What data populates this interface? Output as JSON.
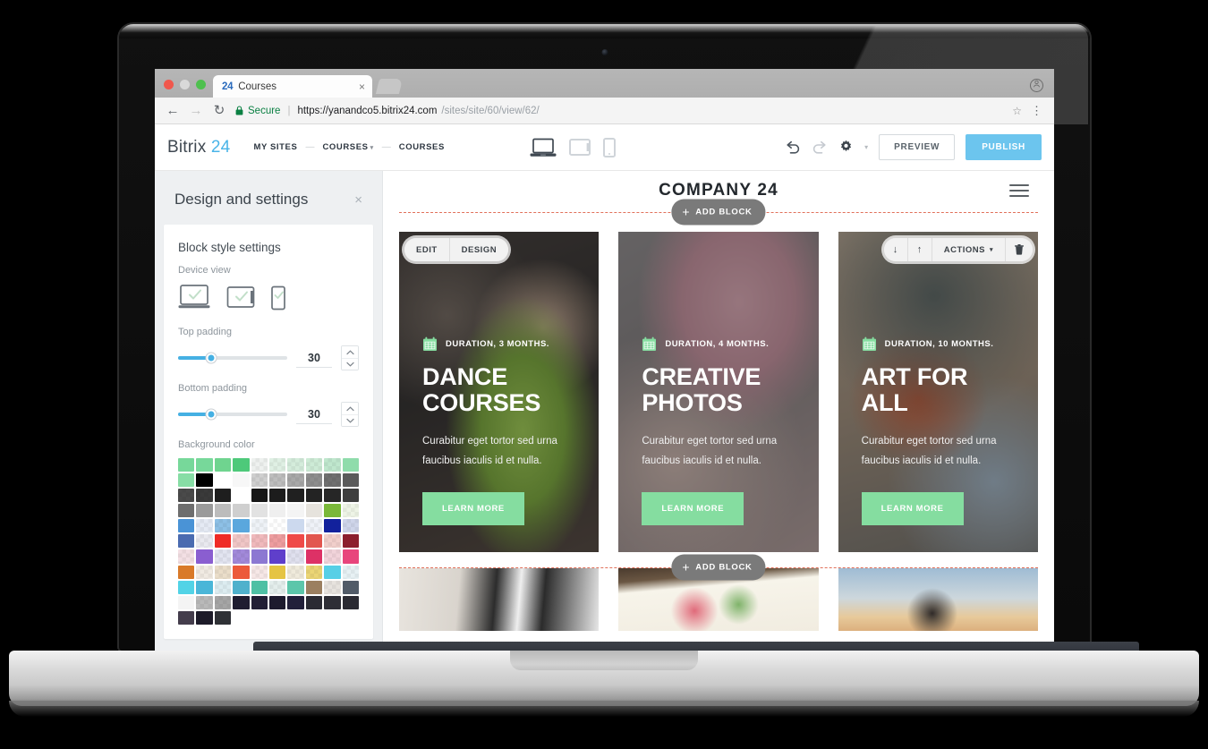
{
  "browser": {
    "tab": {
      "favicon_text": "24",
      "title": "Courses",
      "close_label": "×"
    },
    "newtab_label": "",
    "profile_icon": "ↀ",
    "back_label": "←",
    "forward_label": "→",
    "reload_label": "↻",
    "security_label": "Secure",
    "lock_icon": "🔒",
    "url_strong": "https://yanandco5.bitrix24.com",
    "url_dim": "/sites/site/60/view/62/",
    "star_icon": "☆",
    "menu_icon": "⋮"
  },
  "appbar": {
    "logo_main": "Bitrix",
    "logo_accent": "24",
    "breadcrumbs": [
      {
        "label": "MY SITES",
        "has_caret": false
      },
      {
        "label": "COURSES",
        "has_caret": true
      },
      {
        "label": "COURSES",
        "has_caret": false
      }
    ],
    "crumb_separator": "—",
    "device_views": [
      "desktop-view-icon",
      "tablet-view-icon",
      "mobile-view-icon"
    ],
    "undo_label": "undo-icon",
    "redo_label": "redo-icon",
    "settings_label": "gear-icon",
    "more_caret": "▾",
    "preview_label": "PREVIEW",
    "publish_label": "PUBLISH",
    "accent_color": "#6cc5ee"
  },
  "panel": {
    "title": "Design and settings",
    "close_label": "×",
    "section_title": "Block style settings",
    "device_view_label": "Device view",
    "device_options": [
      {
        "name": "laptop",
        "checked": true,
        "active": true
      },
      {
        "name": "tablet",
        "checked": true,
        "active": false
      },
      {
        "name": "mobile",
        "checked": true,
        "active": false
      }
    ],
    "top_padding": {
      "label": "Top padding",
      "value": "30",
      "percent": 30
    },
    "bottom_padding": {
      "label": "Bottom padding",
      "value": "30",
      "percent": 30
    },
    "background_color_label": "Background color",
    "stepper_up": "▲",
    "stepper_down": "▼",
    "slider_fill_color": "#45b0e3",
    "swatches": [
      {
        "c": "#77d89a"
      },
      {
        "c": "#77d89a"
      },
      {
        "c": "#6fd48f"
      },
      {
        "c": "#4ec97a"
      },
      {
        "c": "#eef1ef",
        "k": true
      },
      {
        "c": "#dff0e4",
        "k": true
      },
      {
        "c": "#d4ecdb",
        "k": true
      },
      {
        "c": "#cdebd6",
        "k": true
      },
      {
        "c": "#bfe7cd",
        "k": true
      },
      {
        "c": "#8fdcab"
      },
      {
        "c": "#87dda5"
      },
      {
        "c": "#000000"
      },
      {
        "c": "#ffffff"
      },
      {
        "c": "#f7f7f7"
      },
      {
        "c": "#cfcfcf",
        "k": true
      },
      {
        "c": "#bdbdbd",
        "k": true
      },
      {
        "c": "#a8a8a8",
        "k": true
      },
      {
        "c": "#8d8d8d",
        "k": true
      },
      {
        "c": "#6f6f6f",
        "k": true
      },
      {
        "c": "#5a5a5a"
      },
      {
        "c": "#4a4a4a",
        "k": true
      },
      {
        "c": "#3a3a3a",
        "k": true
      },
      {
        "c": "#1e1e1e"
      },
      {
        "c": "#ffffff"
      },
      {
        "c": "#171717"
      },
      {
        "c": "#1c1c1c"
      },
      {
        "c": "#202020"
      },
      {
        "c": "#232323"
      },
      {
        "c": "#262626"
      },
      {
        "c": "#3f3f3f"
      },
      {
        "c": "#6e6e6e"
      },
      {
        "c": "#9a9a9a"
      },
      {
        "c": "#bcbcbc"
      },
      {
        "c": "#cfcfcf"
      },
      {
        "c": "#e2e2e2"
      },
      {
        "c": "#efefef"
      },
      {
        "c": "#f4f4f4"
      },
      {
        "c": "#e6e3dd"
      },
      {
        "c": "#7ab839"
      },
      {
        "c": "#eef4e6",
        "k": true
      },
      {
        "c": "#4a93d6"
      },
      {
        "c": "#e5eaf4",
        "k": true
      },
      {
        "c": "#8dc0e6",
        "k": true
      },
      {
        "c": "#5aa7dd"
      },
      {
        "c": "#eef2f7",
        "k": true
      },
      {
        "c": "#ffffff",
        "k": true
      },
      {
        "c": "#ccd9ee"
      },
      {
        "c": "#eff2f8",
        "k": true
      },
      {
        "c": "#12219c"
      },
      {
        "c": "#cfd5ea",
        "k": true
      },
      {
        "c": "#4a6bb0"
      },
      {
        "c": "#e9e9ef",
        "k": true
      },
      {
        "c": "#ef2b26"
      },
      {
        "c": "#f0c6c6",
        "k": true
      },
      {
        "c": "#f0b9bc",
        "k": true
      },
      {
        "c": "#ee9d9f",
        "k": true
      },
      {
        "c": "#ef4a48"
      },
      {
        "c": "#e2564f"
      },
      {
        "c": "#f1cfcb",
        "k": true
      },
      {
        "c": "#8c1e2d"
      },
      {
        "c": "#f3dfe4",
        "k": true
      },
      {
        "c": "#8a5ed0"
      },
      {
        "c": "#e2e4f0",
        "k": true
      },
      {
        "c": "#a289da",
        "k": true
      },
      {
        "c": "#8c78d2"
      },
      {
        "c": "#5f3fcb"
      },
      {
        "c": "#dfe0ee",
        "k": true
      },
      {
        "c": "#dd3166"
      },
      {
        "c": "#f1d3da",
        "k": true
      },
      {
        "c": "#e8457c"
      },
      {
        "c": "#d97a29"
      },
      {
        "c": "#f0eae2",
        "k": true
      },
      {
        "c": "#eaddc9",
        "k": true
      },
      {
        "c": "#ec5a3a"
      },
      {
        "c": "#f6e7e6",
        "k": true
      },
      {
        "c": "#e5c443"
      },
      {
        "c": "#efeadb",
        "k": true
      },
      {
        "c": "#ebd575",
        "k": true
      },
      {
        "c": "#57cfe6"
      },
      {
        "c": "#e7f1f4",
        "k": true
      },
      {
        "c": "#52d3e6"
      },
      {
        "c": "#4ab6d8"
      },
      {
        "c": "#dcecf0",
        "k": true
      },
      {
        "c": "#4fb1cc"
      },
      {
        "c": "#4fc0a4"
      },
      {
        "c": "#e4eeec",
        "k": true
      },
      {
        "c": "#5cc6aa"
      },
      {
        "c": "#9b7f60"
      },
      {
        "c": "#e7e3de",
        "k": true
      },
      {
        "c": "#515b68"
      },
      {
        "c": "#f4f4f4"
      },
      {
        "c": "#b9b9b9",
        "k": true
      },
      {
        "c": "#a5a5a5",
        "k": true
      },
      {
        "c": "#1f1d31"
      },
      {
        "c": "#221f35"
      },
      {
        "c": "#1d1b2e"
      },
      {
        "c": "#22203a"
      },
      {
        "c": "#2b2b33"
      },
      {
        "c": "#2e2e36"
      },
      {
        "c": "#2a2a32"
      },
      {
        "c": "#443d4c"
      },
      {
        "c": "#1d1b29"
      },
      {
        "c": "#2f3136"
      }
    ]
  },
  "canvas": {
    "site_title": "COMPANY 24",
    "menu_icon": "burger-menu-icon",
    "add_block_top_label": "ADD BLOCK",
    "add_block_bottom_label": "ADD BLOCK",
    "add_block_plus": "+",
    "edit_toolbar": {
      "edit_label": "EDIT",
      "design_label": "DESIGN"
    },
    "actions_toolbar": {
      "move_down_icon": "↓",
      "move_up_icon": "↑",
      "actions_label": "ACTIONS",
      "actions_caret": "▾",
      "delete_icon": "trash-icon"
    },
    "button_color": "#85dda0",
    "dashed_color": "#e1705a",
    "cards": [
      {
        "photo": "ph-dance",
        "duration": "DURATION, 3 MONTHS.",
        "title": "DANCE COURSES",
        "description": "Curabitur eget tortor sed urna faucibus iaculis id et nulla.",
        "button_label": "LEARN MORE"
      },
      {
        "photo": "ph-photos",
        "duration": "DURATION, 4 MONTHS.",
        "title": "CREATIVE PHOTOS",
        "description": "Curabitur eget tortor sed urna faucibus iaculis id et nulla.",
        "button_label": "LEARN MORE"
      },
      {
        "photo": "ph-art",
        "duration": "DURATION, 10 MONTHS.",
        "title": "ART FOR ALL",
        "description": "Curabitur eget tortor sed urna faucibus iaculis id et nulla.",
        "button_label": "LEARN MORE"
      }
    ],
    "thumbs": [
      {
        "photo": "ph-piano",
        "name": "piano-thumbnail"
      },
      {
        "photo": "ph-draw",
        "name": "drawing-thumbnail"
      },
      {
        "photo": "ph-couple",
        "name": "couple-thumbnail"
      }
    ]
  }
}
